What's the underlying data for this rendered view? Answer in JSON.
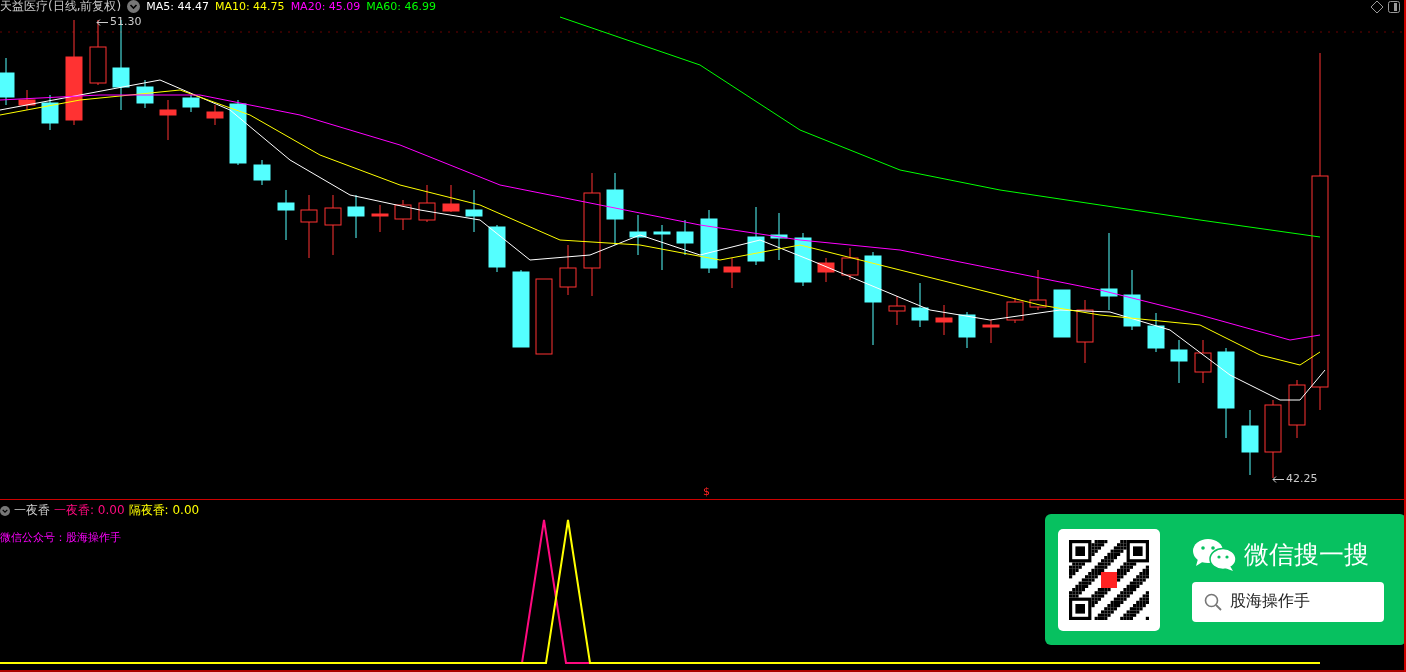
{
  "chart_header": {
    "title": "天益医疗(日线,前复权)",
    "ma_legend": [
      {
        "label": "MA5: 44.47",
        "color": "#ffffff"
      },
      {
        "label": "MA10: 44.75",
        "color": "#ffff00"
      },
      {
        "label": "MA20: 45.09",
        "color": "#ff00ff"
      },
      {
        "label": "MA60: 46.99",
        "color": "#00ff00"
      }
    ]
  },
  "price_marks": [
    {
      "kind": "high",
      "label": "51.30"
    },
    {
      "kind": "low",
      "label": "42.25"
    }
  ],
  "divider_marker": "$",
  "indicator": {
    "name": "一夜香",
    "values": [
      {
        "label": "一夜香: 0.00",
        "color": "#ff0a7f"
      },
      {
        "label": "隔夜香: 0.00",
        "color": "#ffff00"
      }
    ],
    "note": "微信公众号：股海操作手"
  },
  "promo_card": {
    "title": "微信搜一搜",
    "search_text": "股海操作手"
  }
}
